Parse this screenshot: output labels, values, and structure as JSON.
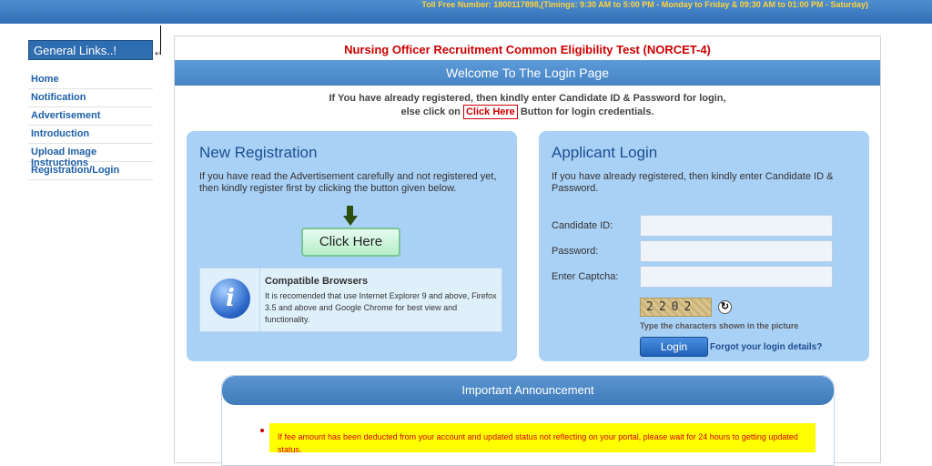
{
  "header": {
    "toll_free": "Toll Free Number: 1800117898,(Timings: 9:30 AM to 5:00 PM - Monday to Friday & 09:30 AM to 01:00 PM - Saturday)"
  },
  "sidebar": {
    "heading": "General Links..!",
    "items": [
      {
        "label": "Home"
      },
      {
        "label": "Notification"
      },
      {
        "label": "Advertisement"
      },
      {
        "label": "Introduction"
      },
      {
        "label": "Upload Image Instructions"
      },
      {
        "label": "Registration/Login"
      }
    ]
  },
  "main": {
    "title": "Nursing Officer Recruitment Common Eligibility Test (NORCET-4)",
    "welcome": "Welcome To The Login Page",
    "intro_line1": "If You have already registered, then kindly enter Candidate ID & Password for login,",
    "intro_prefix": "else click on",
    "intro_link": "Click Here",
    "intro_suffix": "Button for login credentials."
  },
  "registration": {
    "title": "New Registration",
    "text": "If you have read the Advertisement carefully and not registered yet, then kindly register first by clicking the button given below.",
    "button": "Click Here",
    "browsers_title": "Compatible Browsers",
    "browsers_text": "It is recomended that use Internet Explorer 9 and above, Firefox 3.5 and above and Google Chrome for best view and functionality."
  },
  "login": {
    "title": "Applicant Login",
    "text": "If you have already registered, then kindly enter Candidate ID & Password.",
    "candidate_label": "Candidate ID:",
    "candidate_value": "",
    "password_label": "Password:",
    "password_value": "",
    "captcha_label": "Enter Captcha:",
    "captcha_value": "",
    "captcha_code": "2202",
    "captcha_hint": "Type the characters shown in the picture",
    "button": "Login",
    "forgot": "Forgot your login details?"
  },
  "announcement": {
    "heading": "Important Announcement",
    "items": [
      "If fee amount has been deducted from your account and updated status not reflecting on your portal, please wait for 24 hours to getting updated status."
    ]
  },
  "colors": {
    "header_blue": "#2f6db3",
    "toll_free_text": "#ffd23c",
    "title_red": "#cc0000",
    "panel_blue": "#a9d0f5",
    "announcement_highlight": "#ffff00"
  }
}
